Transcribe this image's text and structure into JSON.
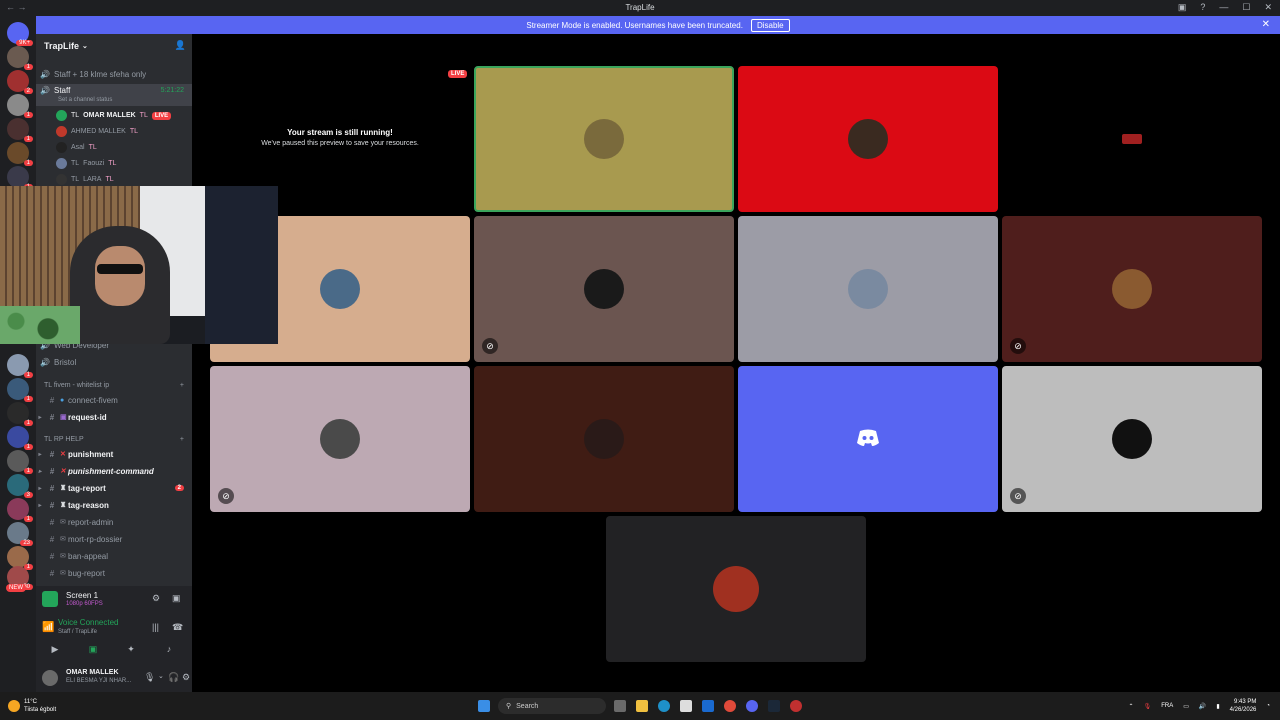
{
  "window": {
    "title": "TrapLife"
  },
  "banner": {
    "text": "Streamer Mode is enabled. Usernames have been truncated.",
    "disable": "Disable"
  },
  "guilds": {
    "home_badge": "9K+",
    "badges": [
      "1",
      "2",
      "1",
      "1",
      "1",
      "1",
      "1",
      "1",
      "1",
      "1",
      "1",
      "3",
      "1",
      "1",
      "1",
      "1",
      "1",
      "1",
      "1",
      "1",
      "23",
      "1",
      "30",
      "NEW"
    ]
  },
  "server": {
    "name": "TrapLife"
  },
  "channels_top": [
    {
      "label": "Staff + 18 klme sfeha only"
    },
    {
      "label": "Staff",
      "time": "5:21:22",
      "status": "Set a channel status"
    }
  ],
  "voice_users": [
    {
      "prefix": "TL",
      "name": "OMAR MALLEK",
      "tag": "TL",
      "live": "LIVE"
    },
    {
      "prefix": "",
      "name": "AHMED MALLEK",
      "tag": "TL",
      "live": ""
    },
    {
      "prefix": "",
      "name": "Asal",
      "tag": "TL",
      "live": ""
    },
    {
      "prefix": "TL",
      "name": "Faouzi",
      "tag": "TL",
      "live": ""
    },
    {
      "prefix": "TL",
      "name": "LARA",
      "tag": "TL",
      "live": ""
    }
  ],
  "mid_channels": [
    {
      "label": "Web Developer"
    },
    {
      "label": "Bristol"
    }
  ],
  "categories": [
    {
      "label": "TL fivem - whitelist ip",
      "channels": [
        {
          "label": "connect-fivem",
          "bold": false
        },
        {
          "label": "request-id",
          "bold": true
        }
      ]
    },
    {
      "label": "TL RP HELP",
      "channels": [
        {
          "label": "punishment",
          "bold": true,
          "mention": ""
        },
        {
          "label": "punishment-command",
          "bold": true,
          "mention": ""
        },
        {
          "label": "tag-report",
          "bold": true,
          "mention": "2"
        },
        {
          "label": "tag-reason",
          "bold": true,
          "mention": ""
        },
        {
          "label": "report-admin",
          "bold": false,
          "mention": ""
        },
        {
          "label": "mort-rp-dossier",
          "bold": false,
          "mention": ""
        },
        {
          "label": "ban-appeal",
          "bold": false,
          "mention": ""
        },
        {
          "label": "bug-report",
          "bold": false,
          "mention": ""
        }
      ]
    }
  ],
  "stream_panel": {
    "title": "Screen 1",
    "sub": "1080p 60FPS"
  },
  "voice_panel": {
    "status": "Voice Connected",
    "location": "Staff / TrapLife"
  },
  "user_panel": {
    "name": "OMAR MALLEK",
    "status": "ELI BESMA YJI NHAR..."
  },
  "stage": {
    "live": "LIVE",
    "paused_title": "Your stream is still running!",
    "paused_sub": "We've paused this preview to save your resources."
  },
  "tiles": [
    {
      "color": "#a89a4f",
      "avatar": "#7a6a3c",
      "muted": false,
      "highlight": true
    },
    {
      "color": "#db0a14",
      "avatar": "#3a2a20",
      "muted": false,
      "highlight": false
    },
    {
      "color": "#000000",
      "avatar": "#000000",
      "muted": false,
      "highlight": false
    },
    {
      "color": "#d6ad8e",
      "avatar": "#4a6a88",
      "muted": false,
      "highlight": false
    },
    {
      "color": "#6b5550",
      "avatar": "#1a1a1a",
      "muted": true,
      "highlight": false
    },
    {
      "color": "#9c9ca6",
      "avatar": "#7a8aa0",
      "muted": false,
      "highlight": false
    },
    {
      "color": "#4f1e1c",
      "avatar": "#8a5a30",
      "muted": true,
      "highlight": false
    },
    {
      "color": "#bda9b3",
      "avatar": "#4a4a4a",
      "muted": true,
      "highlight": false
    },
    {
      "color": "#401c14",
      "avatar": "#2a1a18",
      "muted": false,
      "highlight": false
    },
    {
      "color": "#5865f2",
      "avatar": "#5865f2",
      "muted": false,
      "highlight": false
    },
    {
      "color": "#bdbdbd",
      "avatar": "#111111",
      "muted": true,
      "highlight": false
    },
    {
      "color": "#222224",
      "avatar": "#a03020",
      "muted": false,
      "highlight": false
    }
  ],
  "taskbar": {
    "weather_temp": "11°C",
    "weather_desc": "Tiista égbolt",
    "search": "Search",
    "lang": "FRA",
    "time": "9:43 PM",
    "date": "4/26/2026"
  }
}
